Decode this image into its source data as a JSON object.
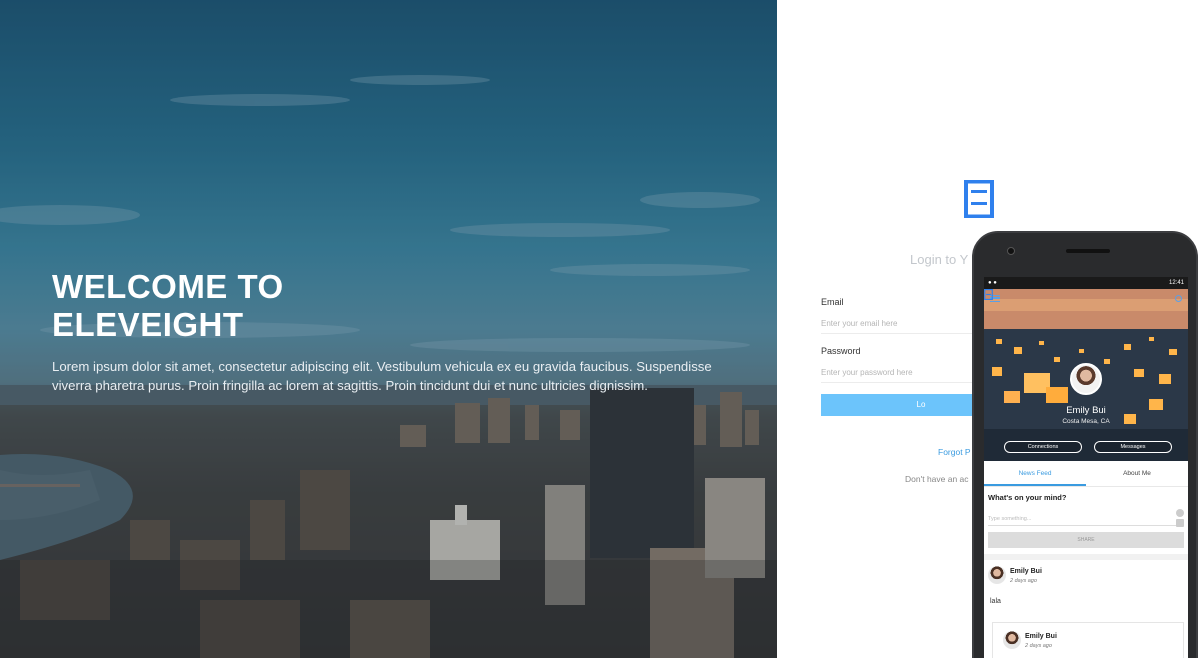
{
  "hero": {
    "title_line1": "WELCOME TO",
    "title_line2": "ELEVEIGHT",
    "text": "Lorem ipsum dolor sit amet, consectetur adipiscing elit. Vestibulum vehicula ex eu gravida faucibus. Suspendisse viverra pharetra purus. Proin fringilla ac lorem at sagittis. Proin tincidunt dui et nunc ultricies dignissim."
  },
  "login": {
    "logo_icon": "eleveight-logo",
    "heading": "Login to Y",
    "email_label": "Email",
    "email_placeholder": "Enter your email here",
    "password_label": "Password",
    "password_placeholder": "Enter your password here",
    "login_button": "Lo",
    "forgot_link": "Forgot P",
    "signup_text": "Don't have an ac"
  },
  "phone": {
    "status_time": "12:41",
    "profile_name": "Emily Bui",
    "profile_location": "Costa Mesa, CA",
    "connections_button": "Connections",
    "messages_button": "Messages",
    "tabs": [
      "News Feed",
      "About Me"
    ],
    "composer_title": "What's on your mind?",
    "composer_placeholder": "Type something...",
    "post_button": "SHARE",
    "posts": [
      {
        "name": "Emily Bui",
        "time": "2 days ago",
        "text": "lala"
      },
      {
        "name": "Emily Bui",
        "time": "2 days ago"
      }
    ]
  },
  "colors": {
    "accent": "#3a9be0",
    "button_light_blue": "#6cc4fb",
    "logo_blue": "#2f80ed"
  }
}
